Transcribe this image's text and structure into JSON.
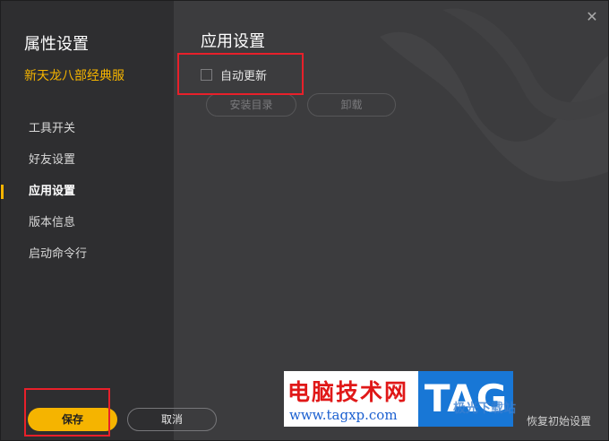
{
  "sidebar": {
    "title": "属性设置",
    "game_name": "新天龙八部经典服",
    "items": [
      {
        "label": "工具开关",
        "active": false
      },
      {
        "label": "好友设置",
        "active": false
      },
      {
        "label": "应用设置",
        "active": true
      },
      {
        "label": "版本信息",
        "active": false
      },
      {
        "label": "启动命令行",
        "active": false
      }
    ]
  },
  "main": {
    "title": "应用设置",
    "auto_update_label": "自动更新",
    "auto_update_checked": false,
    "install_dir_label": "安装目录",
    "uninstall_label": "卸载"
  },
  "footer": {
    "save_label": "保存",
    "cancel_label": "取消",
    "restore_label": "恢复初始设置"
  },
  "watermark": {
    "title": "电脑技术网",
    "url": "www.tagxp.com",
    "tag": "TAG",
    "right_text": "极光下载站"
  },
  "colors": {
    "accent": "#f5b400",
    "highlight": "#e8202a",
    "background": "#3c3c3e",
    "sidebar": "#2e2e30"
  },
  "icons": {
    "close": "close-icon",
    "checkbox": "checkbox-icon"
  }
}
